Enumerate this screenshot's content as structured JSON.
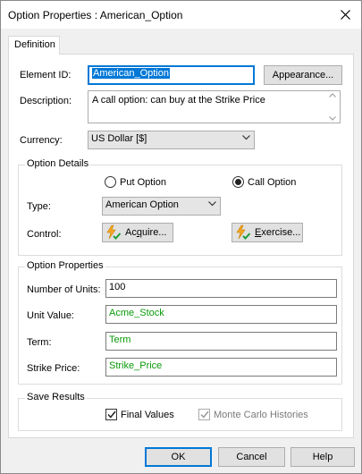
{
  "window": {
    "title": "Option Properties : American_Option"
  },
  "tabs": [
    {
      "label": "Definition"
    }
  ],
  "element": {
    "id_label": "Element ID:",
    "id_value": "American_Option",
    "appearance_button": "Appearance...",
    "description_label": "Description:",
    "description_value": "A call option: can buy at the Strike Price",
    "currency_label": "Currency:",
    "currency_value": "US Dollar [$]"
  },
  "option_details": {
    "group_title": "Option Details",
    "put_label": "Put Option",
    "call_label": "Call Option",
    "selected": "call",
    "type_label": "Type:",
    "type_value": "American Option",
    "control_label": "Control:",
    "acquire_button_pre": "Ac",
    "acquire_button_ul": "q",
    "acquire_button_post": "uire...",
    "exercise_button_ul": "E",
    "exercise_button_post": "xercise..."
  },
  "option_properties": {
    "group_title": "Option Properties",
    "units_label": "Number of Units:",
    "units_value": "100",
    "unit_value_label": "Unit Value:",
    "unit_value_value": "Acme_Stock",
    "term_label": "Term:",
    "term_value": "Term",
    "strike_label": "Strike Price:",
    "strike_value": "Strike_Price"
  },
  "save_results": {
    "group_title": "Save Results",
    "final_values_label": "Final Values",
    "final_values_checked": true,
    "monte_carlo_label": "Monte Carlo Histories",
    "monte_carlo_checked": true
  },
  "footer": {
    "ok": "OK",
    "cancel": "Cancel",
    "help": "Help"
  },
  "colors": {
    "accent": "#0078d7",
    "link_green": "#0a9b0a"
  }
}
